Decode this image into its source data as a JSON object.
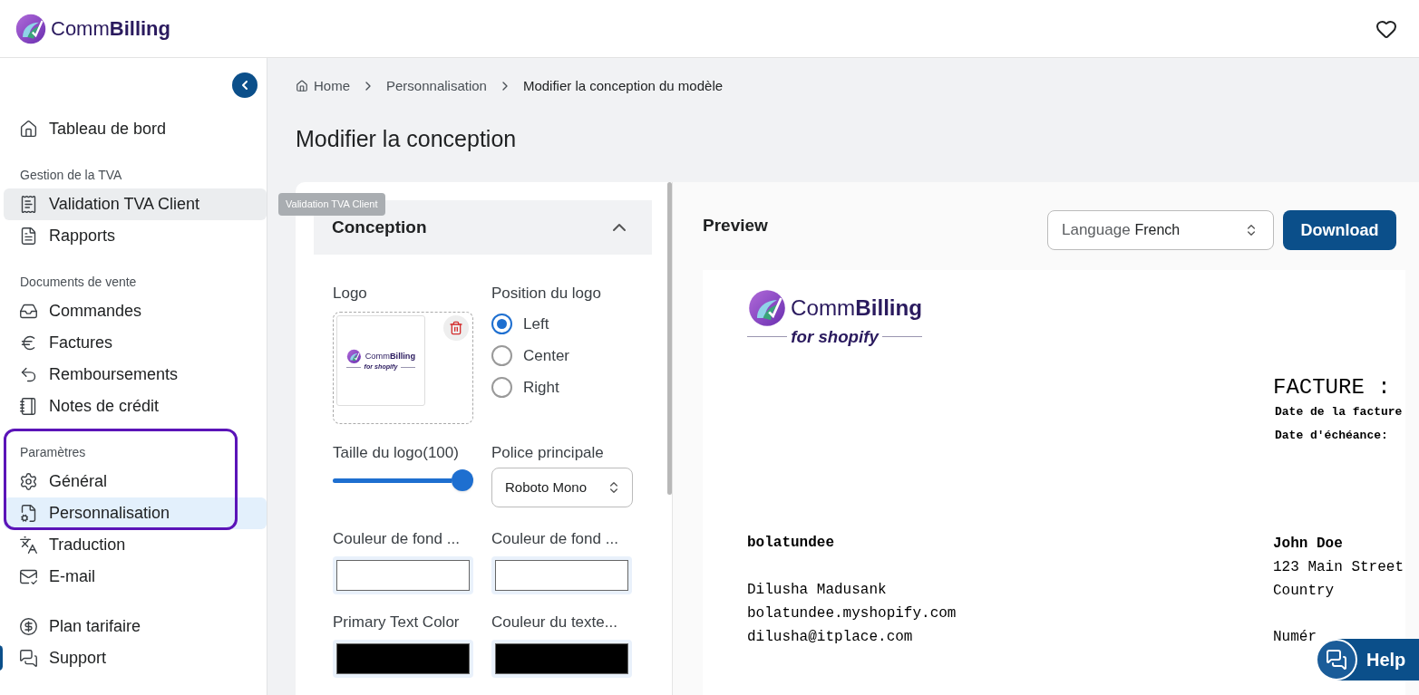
{
  "header": {
    "brand": "Comm**Billing**"
  },
  "sidebar": {
    "sections": [
      {
        "items": [
          {
            "label": "Tableau de bord",
            "selected": false,
            "hovered": false
          }
        ]
      },
      {
        "heading": "Gestion de la TVA",
        "items": [
          {
            "label": "Validation TVA Client",
            "selected": false,
            "hovered": true,
            "tooltip": "Validation TVA Client"
          },
          {
            "label": "Rapports",
            "selected": false,
            "hovered": false
          }
        ]
      },
      {
        "heading": "Documents de vente",
        "items": [
          {
            "label": "Commandes",
            "selected": false,
            "hovered": false
          },
          {
            "label": "Factures",
            "selected": false,
            "hovered": false
          },
          {
            "label": "Remboursements",
            "selected": false,
            "hovered": false
          },
          {
            "label": "Notes de crédit",
            "selected": false,
            "hovered": false
          }
        ]
      },
      {
        "heading": "Paramètres",
        "highlighted": true,
        "items": [
          {
            "label": "Général",
            "selected": false,
            "hovered": false
          },
          {
            "label": "Personnalisation",
            "selected": true,
            "hovered": false
          },
          {
            "label": "Traduction",
            "selected": false,
            "hovered": false
          },
          {
            "label": "E-mail",
            "selected": false,
            "hovered": false
          }
        ]
      },
      {
        "items": [
          {
            "label": "Plan tarifaire",
            "selected": false,
            "hovered": false
          },
          {
            "label": "Support",
            "selected": false,
            "hovered": false
          }
        ]
      }
    ]
  },
  "breadcrumb": [
    "Home",
    "Personnalisation",
    "Modifier la conception du modèle"
  ],
  "title": "Modifier la conception",
  "design": {
    "section_title": "Conception",
    "expanded": true,
    "logo_label": "Logo",
    "logo_thumbnail": {
      "brand": "Comm**Billing**",
      "tagline": "for shopify"
    },
    "position_label": "Position du logo",
    "positions": [
      {
        "label": "Left",
        "selected": true
      },
      {
        "label": "Center",
        "selected": false
      },
      {
        "label": "Right",
        "selected": false
      }
    ],
    "size_label": "Taille du logo(100)",
    "size": {
      "level": 1
    },
    "font_label": "Police principale",
    "font": "Roboto Mono",
    "colors": [
      {
        "label": "Couleur de fond ...",
        "color": "#ffffff"
      },
      {
        "label": "Couleur de fond ...",
        "color": "#ffffff"
      },
      {
        "label": "Primary Text Color",
        "color": "#000000"
      },
      {
        "label": "Couleur du texte...",
        "color": "#000000"
      }
    ]
  },
  "preview": {
    "title": "Preview",
    "language_label": "Language",
    "language": "French",
    "download": "Download",
    "invoice": {
      "logo": {
        "brand": "Comm**Billing**",
        "tagline": "for shopify"
      },
      "heading": "FACTURE :",
      "meta": [
        "Date de la facture",
        "Date d'échéance:"
      ],
      "seller": {
        "name": "bolatundee",
        "lines": [
          "Dilusha Madusank",
          "bolatundee.myshopify.com",
          "dilusha@itplace.com"
        ]
      },
      "buyer": {
        "name": "John Doe",
        "lines": [
          "123 Main Street",
          "Country"
        ],
        "extra": "Numér"
      }
    }
  },
  "help": "Help"
}
